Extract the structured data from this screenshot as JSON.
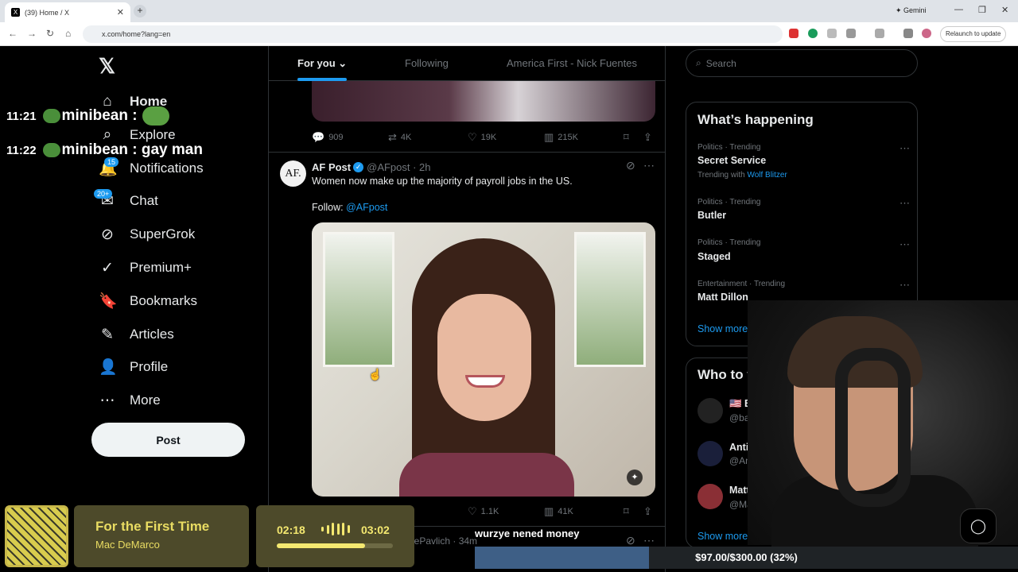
{
  "browser": {
    "tab_title": "(39) Home / X",
    "tab_close": "✕",
    "new_tab": "+",
    "url": "x.com/home?lang=en",
    "gemini": "✦ Gemini",
    "relaunch": "Relaunch to update",
    "window_controls": [
      "—",
      "❐",
      "✕"
    ]
  },
  "sidebar": {
    "logo": "𝕏",
    "items": [
      {
        "icon": "⌂",
        "label": "Home"
      },
      {
        "icon": "⌕",
        "label": "Explore"
      },
      {
        "icon": "🔔",
        "label": "Notifications",
        "badge": "15"
      },
      {
        "icon": "✉",
        "label": "Chat",
        "badge": "20+"
      },
      {
        "icon": "⊘",
        "label": "SuperGrok"
      },
      {
        "icon": "✓",
        "label": "Premium+"
      },
      {
        "icon": "🔖",
        "label": "Bookmarks"
      },
      {
        "icon": "✎",
        "label": "Articles"
      },
      {
        "icon": "👤",
        "label": "Profile"
      },
      {
        "icon": "⋯",
        "label": "More"
      }
    ],
    "post_label": "Post"
  },
  "chat_overlay": [
    {
      "time": "11:21",
      "user": "minibean",
      "message": ""
    },
    {
      "time": "11:22",
      "user": "minibean",
      "message": "gay man"
    }
  ],
  "feed": {
    "tabs": [
      "For you",
      "Following",
      "America First - Nick Fuentes"
    ],
    "active_tab_arrow": "⌄",
    "prev_actions": {
      "replies": "909",
      "reposts": "4K",
      "likes": "19K",
      "views": "215K"
    },
    "tweet": {
      "avatar_text": "AF.",
      "name": "AF Post",
      "verified": "✓",
      "handle": "@AFpost · 2h",
      "text": "Women now make up the majority of payroll jobs in the US.",
      "follow_prefix": "Follow: ",
      "follow_handle": "@AFpost",
      "likes": "1.1K",
      "views": "41K"
    },
    "next_author": "iePavlich · 34m"
  },
  "right": {
    "search_placeholder": "Search",
    "happening_title": "What’s happening",
    "trends": [
      {
        "category": "Politics · Trending",
        "name": "Secret Service",
        "with_prefix": "Trending with ",
        "with": "Wolf Blitzer"
      },
      {
        "category": "Politics · Trending",
        "name": "Butler"
      },
      {
        "category": "Politics · Trending",
        "name": "Staged"
      },
      {
        "category": "Entertainment · Trending",
        "name": "Matt Dillon"
      }
    ],
    "show_more": "Show more",
    "who_title": "Who to follo",
    "who": [
      {
        "name": "🇺🇸 Based",
        "handle": "@based..."
      },
      {
        "name": "AntifaWatc",
        "handle": "@Antifa..."
      },
      {
        "name": "Matt",
        "handle": "@Ma"
      }
    ],
    "who_show_more": "Show more"
  },
  "music": {
    "title": "For the First Time",
    "artist": "Mac DeMarco",
    "elapsed": "02:18",
    "total": "03:02",
    "progress": 0.76
  },
  "overlay_text": "wurzye nened money",
  "goal": {
    "text": "$97.00/$300.00 (32%)",
    "fraction": 0.32
  },
  "icons": {
    "reply": "reply-icon",
    "repost": "repost-icon",
    "like": "heart-icon",
    "views": "views-icon",
    "bookmark": "bookmark-icon",
    "share": "share-icon"
  },
  "colors": {
    "accent": "#1d9bf0",
    "bg": "#000000",
    "music": "#f4e870"
  }
}
